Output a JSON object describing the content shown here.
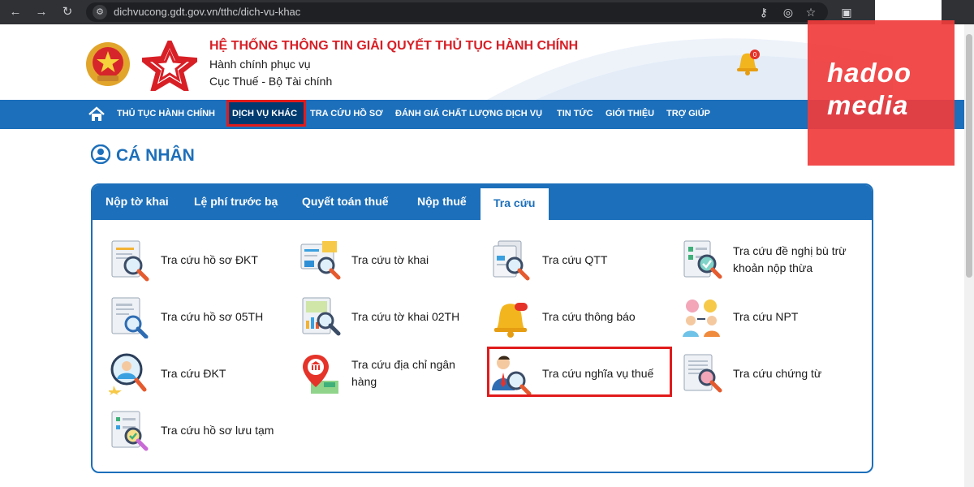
{
  "browser": {
    "url": "dichvucong.gdt.gov.vn/tthc/dich-vu-khac",
    "back_icon": "←",
    "forward_icon": "→",
    "reload_icon": "↻"
  },
  "header": {
    "title": "HỆ THỐNG THÔNG TIN GIẢI QUYẾT THỦ TỤC HÀNH CHÍNH",
    "subtitle_1": "Hành chính phục vụ",
    "subtitle_2": "Cục Thuế - Bộ Tài chính",
    "bell_count": "0"
  },
  "navbar": {
    "items": [
      "THỦ TỤC HÀNH CHÍNH",
      "DỊCH VỤ KHÁC",
      "TRA CỨU HỒ SƠ",
      "ĐÁNH GIÁ CHẤT LƯỢNG DỊCH VỤ",
      "TIN TỨC",
      "GIỚI THIỆU",
      "TRỢ GIÚP"
    ]
  },
  "section": {
    "title": "CÁ NHÂN"
  },
  "tabs": {
    "items": [
      "Nộp tờ khai",
      "Lệ phí trước bạ",
      "Quyết toán thuế",
      "Nộp thuế"
    ],
    "active": "Tra cứu"
  },
  "grid": {
    "items": [
      "Tra cứu hồ sơ ĐKT",
      "Tra cứu tờ khai",
      "Tra cứu QTT",
      "Tra cứu đề nghị bù trừ khoản nộp thừa",
      "Tra cứu hồ sơ 05TH",
      "Tra cứu tờ khai 02TH",
      "Tra cứu thông báo",
      "Tra cứu NPT",
      "Tra cứu ĐKT",
      "Tra cứu địa chỉ ngân hàng",
      "Tra cứu nghĩa vụ thuế",
      "Tra cứu chứng từ",
      "Tra cứu hồ sơ lưu tạm"
    ]
  },
  "watermark": {
    "line_1": "hadoo",
    "line_2": "media"
  },
  "colors": {
    "primary_blue": "#1c6fba",
    "title_red": "#d81f26",
    "highlight_red": "#e11b1b"
  }
}
